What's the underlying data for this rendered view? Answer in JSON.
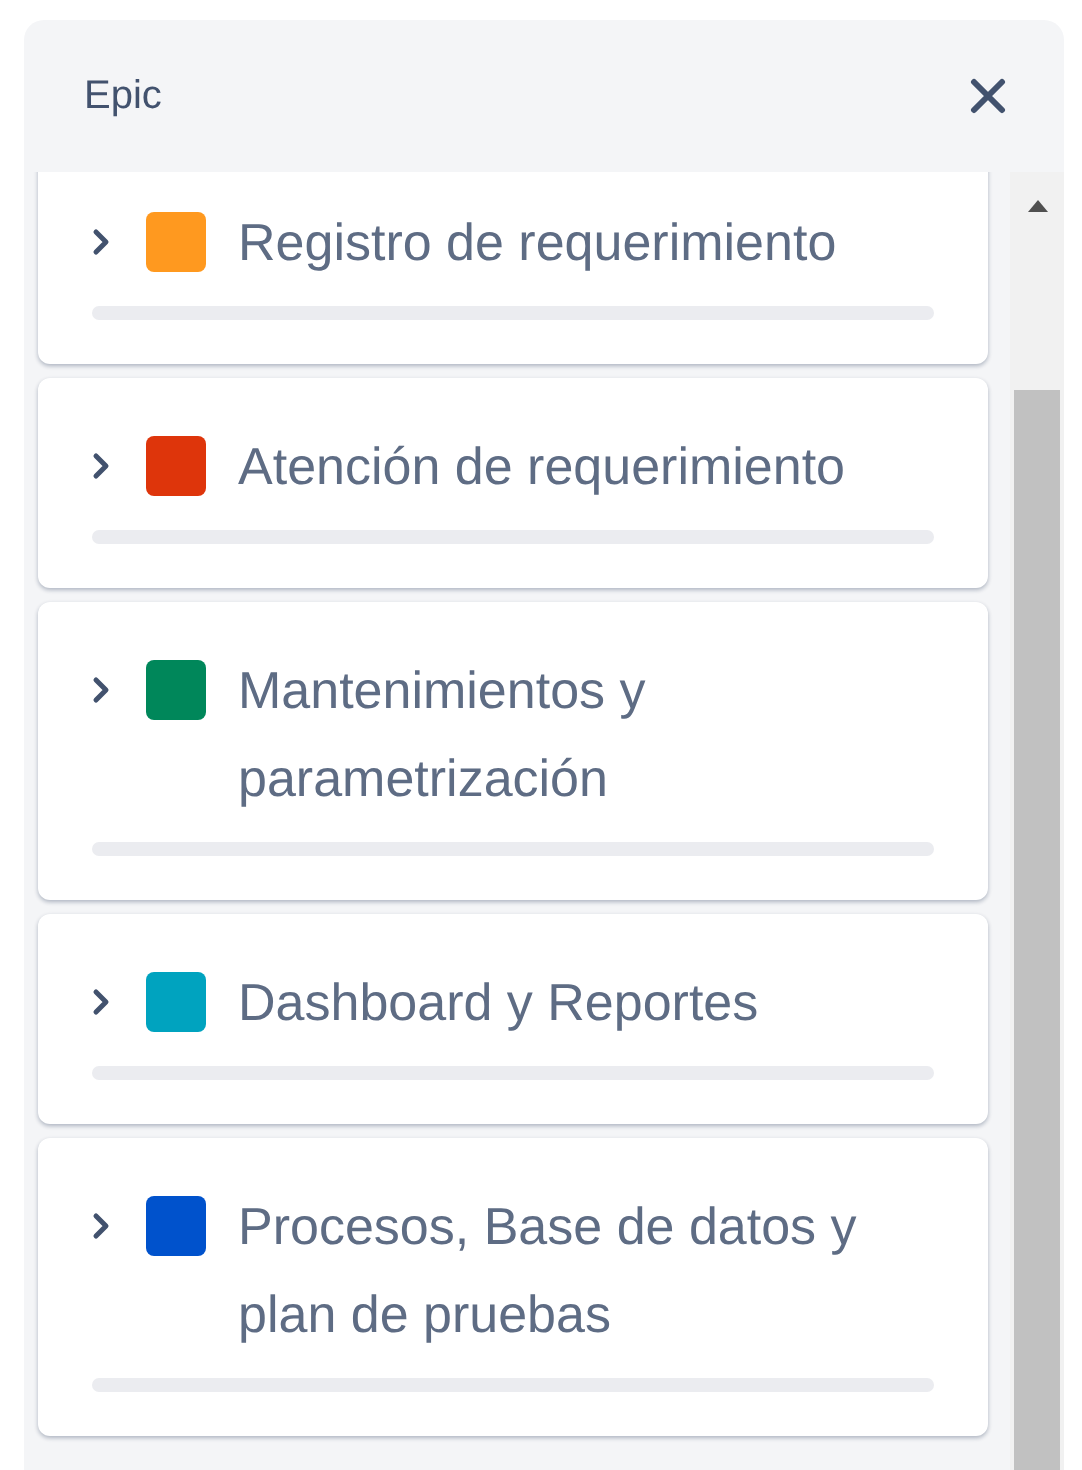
{
  "panel": {
    "title": "Epic"
  },
  "epics": [
    {
      "name": "Registro de requerimiento",
      "color": "#ff991f",
      "expanded": false,
      "level": 0
    },
    {
      "name": "Atención de requerimiento",
      "color": "#de350b",
      "expanded": false,
      "level": 0
    },
    {
      "name": "Mantenimientos y parametrización",
      "color": "#00875a",
      "expanded": false,
      "level": 0
    },
    {
      "name": "Dashboard y Reportes",
      "color": "#00a3bf",
      "expanded": false,
      "level": 0
    },
    {
      "name": "Procesos, Base de datos y plan de pruebas",
      "color": "#0052cc",
      "expanded": false,
      "level": 0
    }
  ]
}
